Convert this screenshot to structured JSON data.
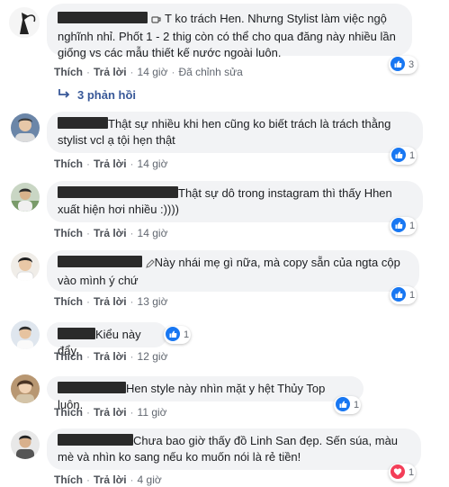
{
  "comments": [
    {
      "text": "T ko trách Hen. Nhưng Stylist làm việc ngộ nghĩnh nhỉ. Phốt 1 - 2 thig còn có thể cho qua đăng này nhiều lần giống vs các mẫu thiết kế nước ngoài luôn.",
      "like": "Thích",
      "reply": "Trả lời",
      "time": "14 giờ",
      "edited": "Đã chỉnh sửa",
      "reaction_icon": "like-icon",
      "reaction_count": "3"
    },
    {
      "text": "Thật sự nhiều khi hen cũng ko biết trách là trách thằng stylist vcl ạ tội hẹn thật",
      "like": "Thích",
      "reply": "Trả lời",
      "time": "14 giờ",
      "reaction_icon": "like-icon",
      "reaction_count": "1"
    },
    {
      "text": "Thật sự dô trong instagram thì thấy Hhen xuất hiện hơi nhiều :))))",
      "like": "Thích",
      "reply": "Trả lời",
      "time": "14 giờ",
      "reaction_icon": "like-icon",
      "reaction_count": "1"
    },
    {
      "text": "Này nhái mẹ gì nữa, mà copy sẵn của ngta cộp vào mình ý chứ",
      "like": "Thích",
      "reply": "Trả lời",
      "time": "13 giờ",
      "reaction_icon": "like-icon",
      "reaction_count": "1"
    },
    {
      "text": "Kiểu này đẩy",
      "like": "Thích",
      "reply": "Trả lời",
      "time": "12 giờ",
      "reaction_icon": "like-icon",
      "reaction_count": "1"
    },
    {
      "text": "Hen style này nhìn mặt y hệt Thủy Top luôn.",
      "like": "Thích",
      "reply": "Trả lời",
      "time": "11 giờ",
      "reaction_icon": "like-icon",
      "reaction_count": "1"
    },
    {
      "text": "Chưa bao giờ thấy đồ Linh San đẹp. Sến súa, màu mè và nhìn ko sang nếu ko muốn nói là rẻ tiền!",
      "like": "Thích",
      "reply": "Trả lời",
      "time": "4 giờ",
      "reaction_icon": "love-icon",
      "reaction_count": "1"
    }
  ],
  "replies_toggle": {
    "label": "3 phản hồi"
  },
  "colors": {
    "like_blue": "#1877f2",
    "love_red": "#f33e58",
    "link_blue": "#385898",
    "bubble_bg": "#f2f3f5"
  }
}
